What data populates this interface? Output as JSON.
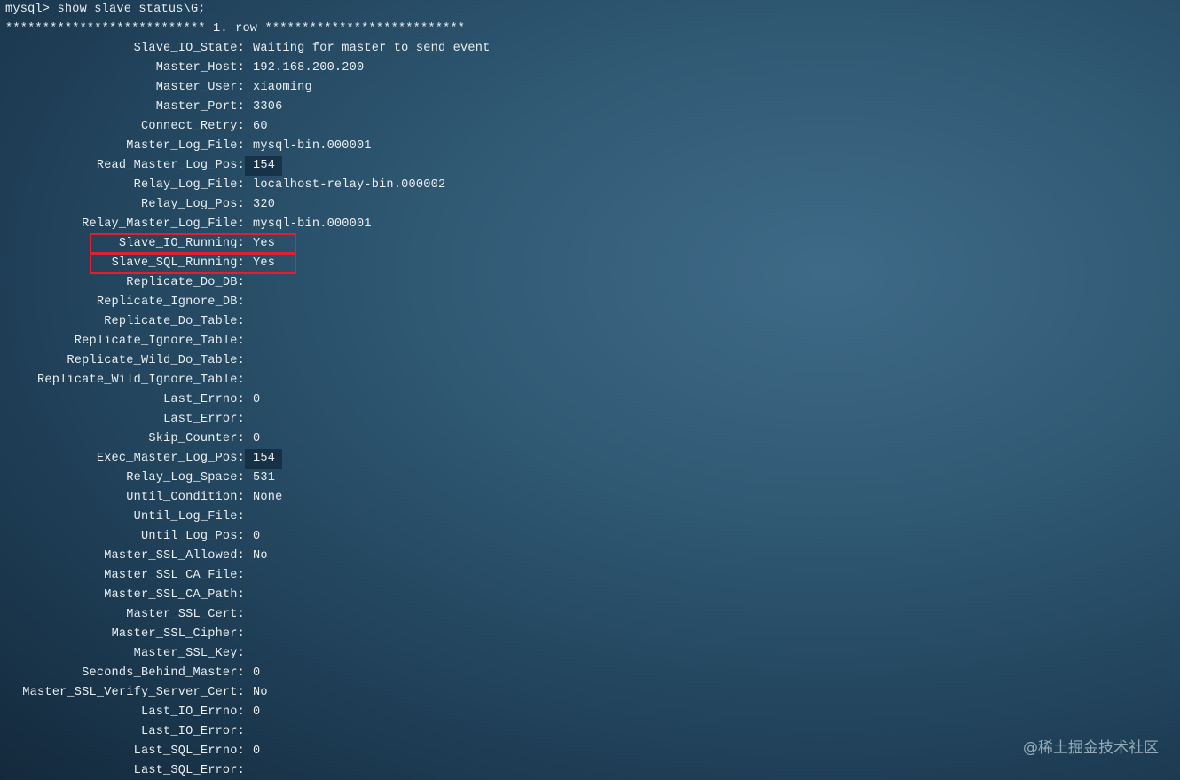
{
  "terminal": {
    "prompt_line": "mysql> show slave status\\G;",
    "header_line": "*************************** 1. row ***************************",
    "rows": [
      {
        "field": "Slave_IO_State:",
        "value": "Waiting for master to send event"
      },
      {
        "field": "Master_Host:",
        "value": "192.168.200.200"
      },
      {
        "field": "Master_User:",
        "value": "xiaoming"
      },
      {
        "field": "Master_Port:",
        "value": "3306"
      },
      {
        "field": "Connect_Retry:",
        "value": "60"
      },
      {
        "field": "Master_Log_File:",
        "value": "mysql-bin.000001"
      },
      {
        "field": "Read_Master_Log_Pos:",
        "value": "154",
        "highlight": true
      },
      {
        "field": "Relay_Log_File:",
        "value": "localhost-relay-bin.000002"
      },
      {
        "field": "Relay_Log_Pos:",
        "value": "320"
      },
      {
        "field": "Relay_Master_Log_File:",
        "value": "mysql-bin.000001"
      },
      {
        "field": "Slave_IO_Running:",
        "value": "Yes",
        "boxed": true
      },
      {
        "field": "Slave_SQL_Running:",
        "value": "Yes",
        "boxed": true
      },
      {
        "field": "Replicate_Do_DB:",
        "value": ""
      },
      {
        "field": "Replicate_Ignore_DB:",
        "value": ""
      },
      {
        "field": "Replicate_Do_Table:",
        "value": ""
      },
      {
        "field": "Replicate_Ignore_Table:",
        "value": ""
      },
      {
        "field": "Replicate_Wild_Do_Table:",
        "value": ""
      },
      {
        "field": "Replicate_Wild_Ignore_Table:",
        "value": ""
      },
      {
        "field": "Last_Errno:",
        "value": "0"
      },
      {
        "field": "Last_Error:",
        "value": ""
      },
      {
        "field": "Skip_Counter:",
        "value": "0"
      },
      {
        "field": "Exec_Master_Log_Pos:",
        "value": "154",
        "highlight": true
      },
      {
        "field": "Relay_Log_Space:",
        "value": "531"
      },
      {
        "field": "Until_Condition:",
        "value": "None"
      },
      {
        "field": "Until_Log_File:",
        "value": ""
      },
      {
        "field": "Until_Log_Pos:",
        "value": "0"
      },
      {
        "field": "Master_SSL_Allowed:",
        "value": "No"
      },
      {
        "field": "Master_SSL_CA_File:",
        "value": ""
      },
      {
        "field": "Master_SSL_CA_Path:",
        "value": ""
      },
      {
        "field": "Master_SSL_Cert:",
        "value": ""
      },
      {
        "field": "Master_SSL_Cipher:",
        "value": ""
      },
      {
        "field": "Master_SSL_Key:",
        "value": ""
      },
      {
        "field": "Seconds_Behind_Master:",
        "value": "0"
      },
      {
        "field": "Master_SSL_Verify_Server_Cert:",
        "value": "No"
      },
      {
        "field": "Last_IO_Errno:",
        "value": "0"
      },
      {
        "field": "Last_IO_Error:",
        "value": ""
      },
      {
        "field": "Last_SQL_Errno:",
        "value": "0"
      },
      {
        "field": "Last_SQL_Error:",
        "value": ""
      }
    ]
  },
  "watermark": "@稀土掘金技术社区",
  "colors": {
    "text": "#e9eef2",
    "highlight_box": "#e02030",
    "background": "#2f5873"
  }
}
